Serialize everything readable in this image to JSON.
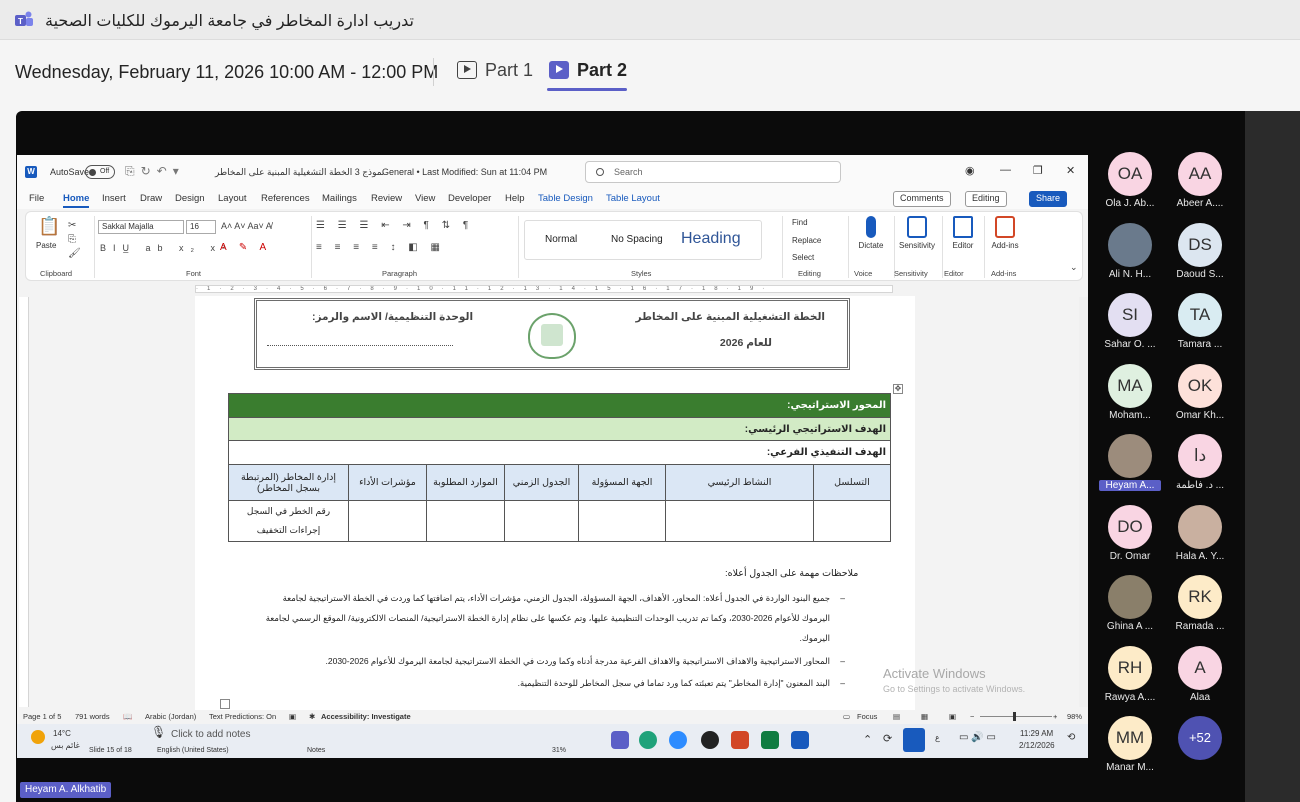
{
  "teams": {
    "title": "تدريب ادارة المخاطر في جامعة اليرموك للكليات الصحية",
    "datetime": "Wednesday, February 11, 2026 10:00 AM - 12:00 PM",
    "parts": [
      "Part 1",
      "Part 2"
    ],
    "presenter": "Heyam A. Alkhatib",
    "accent": "#5b5fc7"
  },
  "word": {
    "autosave": "AutoSave",
    "autosave_state": "Off",
    "doc_title": "نموذج 3 الخطة التشغيلية المبنية على المخاطر",
    "sensitivity": "General • Last Modified: Sun at 11:04 PM",
    "search_placeholder": "Search",
    "tabs": [
      "File",
      "Home",
      "Insert",
      "Draw",
      "Design",
      "Layout",
      "References",
      "Mailings",
      "Review",
      "View",
      "Developer",
      "Help",
      "Table Design",
      "Table Layout"
    ],
    "comments": "Comments",
    "editing": "Editing",
    "share": "Share",
    "ribbon": {
      "paste": "Paste",
      "font": "Sakkal Majalla",
      "size": "16",
      "groups": [
        "Clipboard",
        "Font",
        "Paragraph",
        "Styles",
        "Editing",
        "Voice",
        "Sensitivity",
        "Editor",
        "Add-ins"
      ],
      "styles": [
        "Normal",
        "No Spacing",
        "Heading"
      ],
      "find": "Find",
      "replace": "Replace",
      "select": "Select",
      "dictate": "Dictate",
      "sensitivity": "Sensitivity",
      "editor": "Editor",
      "addins": "Add-ins"
    },
    "doc": {
      "header_right_1": "الخطة التشغيلية المبنية على المخاطر",
      "header_right_2": "للعام 2026",
      "header_left": "الوحدة التنظيمية/ الاسم والرمز:",
      "row1": "المحور الاستراتيجي:",
      "row2": "الهدف الاستراتيجي الرئيسي:",
      "row3": "الهدف التنفيذي الفرعي:",
      "columns": [
        "التسلسل",
        "النشاط الرئيسي",
        "الجهة المسؤولة",
        "الجدول الزمني",
        "الموارد المطلوبة",
        "مؤشرات الأداء",
        "إدارة المخاطر (المرتبطة بسجل المخاطر)"
      ],
      "risk_cell_1": "رقم الخطر في السجل",
      "risk_cell_2": "إجراءات التخفيف",
      "notes_title": "ملاحظات مهمة على الجدول أعلاه:",
      "bullets": [
        "جميع البنود الواردة في الجدول أعلاه: المحاور، الأهداف، الجهة المسؤولة، الجدول الزمني، مؤشرات الأداء، يتم اضافتها كما وردت في الخطة الاستراتيجية لجامعة اليرموك للأعوام 2026-2030، وكما تم تدريب الوحدات التنظيمية عليها، وتم عكسها على نظام إدارة الخطة الاستراتيجية/ المنصات الالكترونية/ الموقع الرسمي لجامعة اليرموك.",
        "المحاور الاستراتيجية والاهداف الاستراتيجية والاهداف الفرعية مدرجة أدناه وكما وردت في الخطة الاستراتيجية لجامعة اليرموك للأعوام 2026-2030.",
        "البند المعنون \"إدارة المخاطر\" يتم تعبئته كما ورد تماما في سجل المخاطر للوحدة التنظيمية."
      ]
    },
    "activate_1": "Activate Windows",
    "activate_2": "Go to Settings to activate Windows.",
    "status": {
      "page": "Page 1 of 5",
      "words": "791 words",
      "lang": "Arabic (Jordan)",
      "predictions": "Text Predictions: On",
      "accessibility": "Accessibility: Investigate",
      "focus": "Focus",
      "zoom": "98%"
    },
    "taskbar": {
      "temp": "14°C",
      "weather": "غائم بس",
      "notes_prompt": "Click to add notes",
      "slide": "Slide 15 of 18",
      "slide_lang": "English (United States)",
      "notes": "Notes",
      "slide_zoom": "31%",
      "lang_indicator": "ع",
      "time": "11:29 AM",
      "date": "2/12/2026"
    }
  },
  "participants": [
    {
      "initials": "OA",
      "name": "Ola J. Ab...",
      "color": "#f9d5e3"
    },
    {
      "initials": "AA",
      "name": "Abeer A....",
      "color": "#f9d5e3"
    },
    {
      "initials": "",
      "name": "Ali N. H...",
      "color": "#6a7a8c"
    },
    {
      "initials": "DS",
      "name": "Daoud S...",
      "color": "#dce6f0"
    },
    {
      "initials": "SI",
      "name": "Sahar O. ...",
      "color": "#e3dff2"
    },
    {
      "initials": "TA",
      "name": "Tamara ...",
      "color": "#d9ecf2"
    },
    {
      "initials": "MA",
      "name": "Moham...",
      "color": "#dff0e0"
    },
    {
      "initials": "OK",
      "name": "Omar Kh...",
      "color": "#fde1da"
    },
    {
      "initials": "",
      "name": "Heyam A...",
      "color": "#9c8c7c"
    },
    {
      "initials": "دا",
      "name": "د. فاطمة ...",
      "color": "#f9d5e3"
    },
    {
      "initials": "DO",
      "name": "Dr. Omar",
      "color": "#f9d5e3"
    },
    {
      "initials": "",
      "name": "Hala A. Y...",
      "color": "#c9b0a0"
    },
    {
      "initials": "",
      "name": "Ghina A ...",
      "color": "#8a7f6a"
    },
    {
      "initials": "RK",
      "name": "Ramada ...",
      "color": "#fdebc8"
    },
    {
      "initials": "RH",
      "name": "Rawya A....",
      "color": "#fdebc8"
    },
    {
      "initials": "A",
      "name": "Alaa",
      "color": "#f9d5e3"
    },
    {
      "initials": "MM",
      "name": "Manar M...",
      "color": "#fdebc8"
    },
    {
      "initials": "+52",
      "name": "",
      "color": "#4f52b2"
    }
  ]
}
